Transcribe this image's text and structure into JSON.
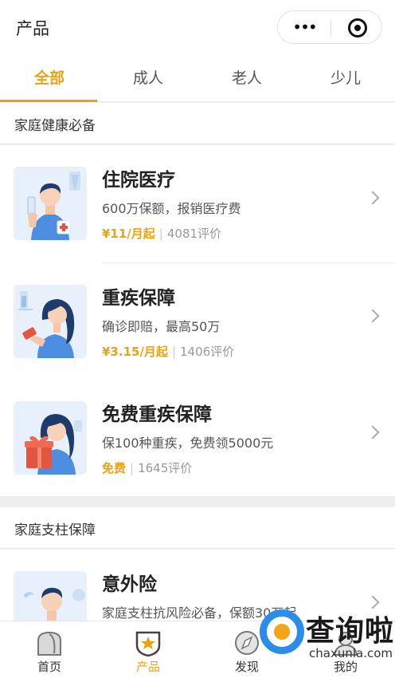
{
  "header": {
    "title": "产品"
  },
  "tabs": [
    {
      "label": "全部",
      "active": true
    },
    {
      "label": "成人",
      "active": false
    },
    {
      "label": "老人",
      "active": false
    },
    {
      "label": "少儿",
      "active": false
    }
  ],
  "sections": [
    {
      "title": "家庭健康必备",
      "items": [
        {
          "title": "住院医疗",
          "desc": "600万保额，报销医疗费",
          "price": "¥11/月起",
          "reviews": "4081评价"
        },
        {
          "title": "重疾保障",
          "desc": "确诊即赔，最高50万",
          "price": "¥3.15/月起",
          "reviews": "1406评价"
        },
        {
          "title": "免费重疾保障",
          "desc": "保100种重疾，免费领5000元",
          "price": "免费",
          "reviews": "1645评价"
        }
      ]
    },
    {
      "title": "家庭支柱保障",
      "items": [
        {
          "title": "意外险",
          "desc": "家庭支柱抗风险必备，保额30万起",
          "price": "",
          "reviews": ""
        }
      ]
    }
  ],
  "tabbar": [
    {
      "label": "首页",
      "icon": "home-icon",
      "active": false
    },
    {
      "label": "产品",
      "icon": "product-shield-icon",
      "active": true
    },
    {
      "label": "发现",
      "icon": "discover-compass-icon",
      "active": false
    },
    {
      "label": "我的",
      "icon": "profile-icon",
      "active": false
    }
  ],
  "watermark": {
    "text": "查询啦",
    "sub": "chaxunla.com"
  },
  "colors": {
    "accent": "#e9a215",
    "background": "#f2f2f2",
    "thumb_bg": "#e8f1fb",
    "watermark_blue": "#2b8de8"
  }
}
